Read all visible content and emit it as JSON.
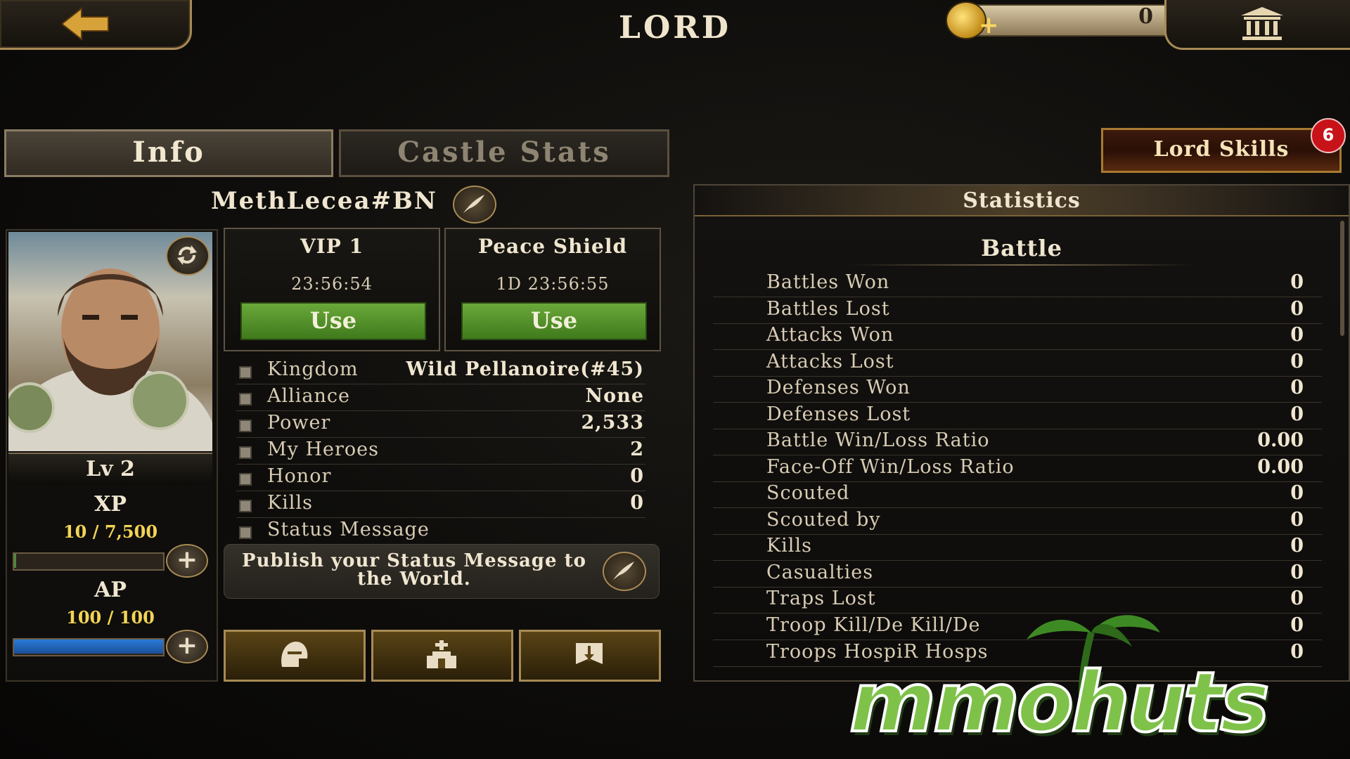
{
  "header": {
    "title": "LORD",
    "gold_amount": "0"
  },
  "tabs": [
    {
      "label": "Info",
      "active": true
    },
    {
      "label": "Castle Stats",
      "active": false
    }
  ],
  "lord_skills": {
    "label": "Lord Skills",
    "badge": "6"
  },
  "profile": {
    "name": "MethLecea#BN",
    "level": "Lv 2",
    "xp_label": "XP",
    "xp_value": "10 / 7,500",
    "xp_fraction": 0.0013,
    "ap_label": "AP",
    "ap_value": "100 / 100",
    "ap_fraction": 1.0
  },
  "vip": {
    "title": "VIP 1",
    "time": "23:56:54",
    "button": "Use"
  },
  "shield": {
    "title": "Peace Shield",
    "time": "1D 23:56:55",
    "button": "Use"
  },
  "info": [
    {
      "label": "Kingdom",
      "value": "Wild Pellanoire(#45)"
    },
    {
      "label": "Alliance",
      "value": "None"
    },
    {
      "label": "Power",
      "value": "2,533"
    },
    {
      "label": "My Heroes",
      "value": "2"
    },
    {
      "label": "Honor",
      "value": "0"
    },
    {
      "label": "Kills",
      "value": "0"
    },
    {
      "label": "Status Message",
      "value": ""
    }
  ],
  "status_message": {
    "placeholder": "Publish your Status Message to the World."
  },
  "statistics": {
    "title": "Statistics",
    "section": "Battle",
    "rows": [
      {
        "label": "Battles Won",
        "value": "0"
      },
      {
        "label": "Battles Lost",
        "value": "0"
      },
      {
        "label": "Attacks Won",
        "value": "0"
      },
      {
        "label": "Attacks Lost",
        "value": "0"
      },
      {
        "label": "Defenses Won",
        "value": "0"
      },
      {
        "label": "Defenses Lost",
        "value": "0"
      },
      {
        "label": "Battle Win/Loss Ratio",
        "value": "0.00"
      },
      {
        "label": "Face-Off Win/Loss Ratio",
        "value": "0.00"
      },
      {
        "label": "Scouted",
        "value": "0"
      },
      {
        "label": "Scouted by",
        "value": "0"
      },
      {
        "label": "Kills",
        "value": "0"
      },
      {
        "label": "Casualties",
        "value": "0"
      },
      {
        "label": "Traps Lost",
        "value": "0"
      },
      {
        "label": "Troop Kill/De Kill/De",
        "value": "0"
      },
      {
        "label": "Troops HospiR Hosps",
        "value": "0"
      }
    ]
  },
  "watermark": {
    "text": "mmohuts"
  },
  "icons": {
    "back": "back-arrow-icon",
    "gold": "gold-coin-icon",
    "bank": "bank-icon",
    "edit": "quill-icon",
    "refresh": "refresh-icon",
    "armor": "helmet-icon",
    "castle": "castle-icon",
    "banner": "banner-icon"
  },
  "colors": {
    "accent": "#a88a55",
    "use_button": "#4f8f28",
    "xp_value": "#f3d454",
    "badge": "#c8121a"
  }
}
